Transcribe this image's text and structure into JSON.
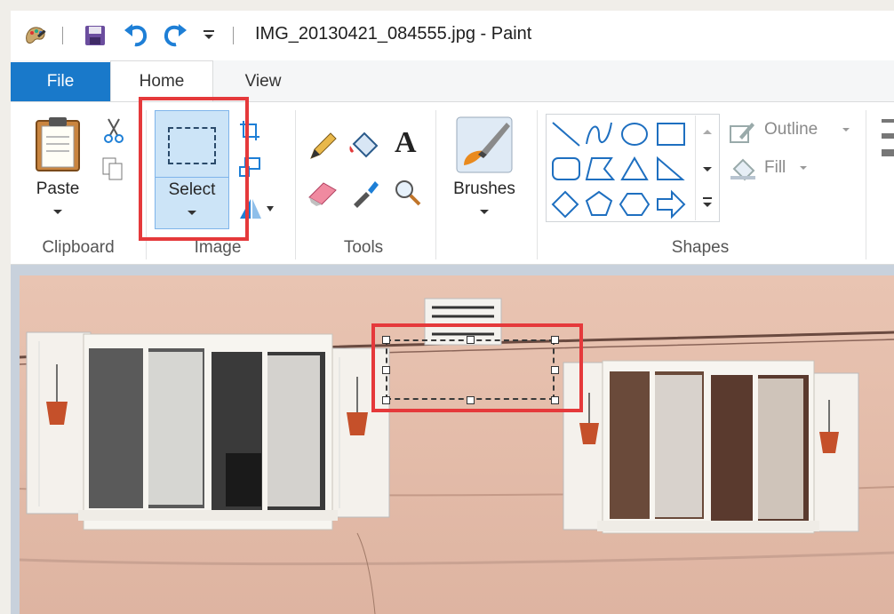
{
  "titlebar": {
    "title": "IMG_20130421_084555.jpg - Paint",
    "quick_access": [
      "paint-app-icon",
      "save-icon",
      "undo-icon",
      "redo-icon",
      "customize-dropdown-icon"
    ]
  },
  "tabs": {
    "file": "File",
    "home": "Home",
    "view": "View"
  },
  "ribbon": {
    "clipboard": {
      "label": "Clipboard",
      "paste": "Paste"
    },
    "image": {
      "label": "Image",
      "select": "Select"
    },
    "tools": {
      "label": "Tools"
    },
    "brushes": {
      "label": "Brushes"
    },
    "shapes": {
      "label": "Shapes",
      "outline": "Outline",
      "fill": "Fill"
    }
  },
  "colors": {
    "file_tab": "#1979ca",
    "selected_button": "#cce4f7",
    "highlight": "#e5393b",
    "wall": "#e6bfae"
  }
}
